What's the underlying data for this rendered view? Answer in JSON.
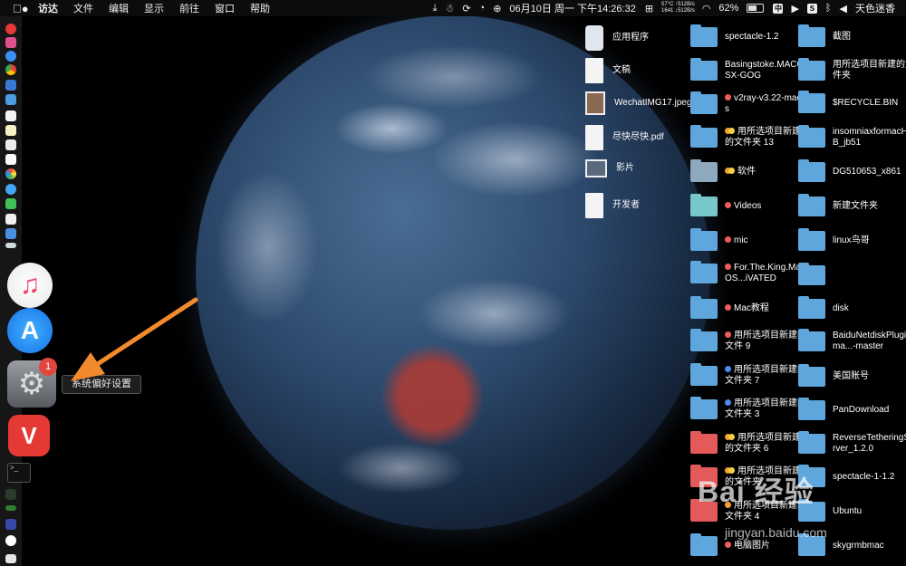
{
  "menubar": {
    "apple": "",
    "items": [
      "访达",
      "文件",
      "编辑",
      "显示",
      "前往",
      "窗口",
      "帮助"
    ],
    "stats_temp": "57°C",
    "stats_rpm": "1641",
    "stats_up": "↑512B/s",
    "stats_down": "↓512B/s",
    "datetime": "06月10日 周一 下午14:26:32",
    "battery": "62%",
    "input_method": "中",
    "user": "天色迷香"
  },
  "dock": {
    "badge_count": "1",
    "tooltip": "系统偏好设置",
    "terminal_text": ">_"
  },
  "desktop": {
    "col1": [
      {
        "name": "应用程序"
      },
      {
        "name": "文稿"
      },
      {
        "name": "WechatIMG17.jpeg"
      },
      {
        "name": "尽快尽快.pdf"
      },
      {
        "name": "影片"
      },
      {
        "name": "开发者"
      }
    ],
    "col2": [
      {
        "name": "spectacle-1.2"
      },
      {
        "name": "Basingstoke.MACOSX-GOG"
      },
      {
        "name": "v2ray-v3.22-macos",
        "tag": "red"
      },
      {
        "name": "用所选项目新建的文件夹 13",
        "tag": "orange"
      },
      {
        "name": "软件",
        "tag": "orange"
      },
      {
        "name": "Videos",
        "tag": "red"
      },
      {
        "name": "mic",
        "tag": "red"
      },
      {
        "name": "For.The.King.MacOS...iVATED",
        "tag": "red"
      },
      {
        "name": "Mac教程",
        "tag": "red"
      },
      {
        "name": "用所选项目新建的文件 9",
        "tag": "red"
      },
      {
        "name": "用所选项目新建的文件夹 7",
        "tag": "blue"
      },
      {
        "name": "用所选项目新建的文件夹 3",
        "tag": "blue"
      },
      {
        "name": "用所选项目新建的文件夹 6",
        "tag": "orange"
      },
      {
        "name": "用所选项目新建的文件夹",
        "tag": "orange"
      },
      {
        "name": "用所选项目新建的文件夹 4",
        "tag": "orange"
      },
      {
        "name": "电脑图片",
        "tag": "red"
      }
    ],
    "col3": [
      {
        "name": "截图"
      },
      {
        "name": "用所选项目新建的文件夹"
      },
      {
        "name": "$RECYCLE.BIN"
      },
      {
        "name": "insomniaxformacHHB_jb51"
      },
      {
        "name": "DG510653_x861"
      },
      {
        "name": "新建文件夹"
      },
      {
        "name": "linux鸟哥"
      },
      {
        "name": ""
      },
      {
        "name": "disk"
      },
      {
        "name": "BaiduNetdiskPlugin-ma...-master"
      },
      {
        "name": "美国账号"
      },
      {
        "name": "PanDownload"
      },
      {
        "name": "ReverseTetheringServer_1.2.0"
      },
      {
        "name": "spectacle-1-1.2"
      },
      {
        "name": "Ubuntu"
      },
      {
        "name": "skygrmbmac"
      }
    ]
  },
  "watermark": {
    "main": "Bai 经验",
    "sub": "jingyan.baidu.com"
  }
}
